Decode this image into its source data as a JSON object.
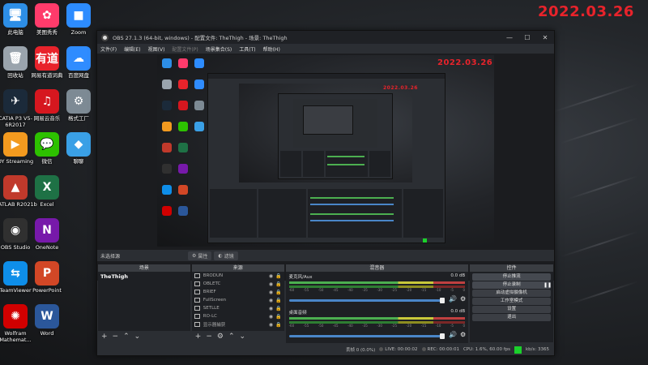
{
  "desktop": {
    "date_stamp": "2022.03.26",
    "icons": [
      {
        "label": "此电脑",
        "icon": "computer-icon",
        "color": "#2d8ee6",
        "glyph": "🖥"
      },
      {
        "label": "美图秀秀",
        "icon": "meitu-icon",
        "color": "#ff3b6b",
        "glyph": "✿"
      },
      {
        "label": "Zoom",
        "icon": "zoom-icon",
        "color": "#2d8cff",
        "glyph": "■"
      },
      {
        "label": "回收站",
        "icon": "recycle-bin-icon",
        "color": "#9aa4ad",
        "glyph": "🗑"
      },
      {
        "label": "网易有道词典",
        "icon": "youdao-icon",
        "color": "#e8232b",
        "glyph": "有道"
      },
      {
        "label": "百度网盘",
        "icon": "baidu-netdisk-icon",
        "color": "#2f8cff",
        "glyph": "☁"
      },
      {
        "label": "CATIA P3 V5-6R2017",
        "icon": "catia-icon",
        "color": "#1b2a3a",
        "glyph": "✈"
      },
      {
        "label": "网易云音乐",
        "icon": "netease-music-icon",
        "color": "#d6171f",
        "glyph": "♫"
      },
      {
        "label": "格式工厂",
        "icon": "format-factory-icon",
        "color": "#7d8a94",
        "glyph": "⚙"
      },
      {
        "label": "DY Streaming",
        "icon": "dy-streaming-icon",
        "color": "#f39a1f",
        "glyph": "▶"
      },
      {
        "label": "微信",
        "icon": "wechat-icon",
        "color": "#2dc100",
        "glyph": "💬"
      },
      {
        "label": "聊聊",
        "icon": "chat-icon",
        "color": "#3aa0e6",
        "glyph": "◆"
      },
      {
        "label": "MATLAB R2021b",
        "icon": "matlab-icon",
        "color": "#c0392b",
        "glyph": "▲"
      },
      {
        "label": "Excel",
        "icon": "excel-icon",
        "color": "#1e7145",
        "glyph": "X"
      },
      {
        "label": "OBS Studio",
        "icon": "obs-icon",
        "color": "#303030",
        "glyph": "◉"
      },
      {
        "label": "OneNote",
        "icon": "onenote-icon",
        "color": "#7719aa",
        "glyph": "N"
      },
      {
        "label": "TeamViewer",
        "icon": "teamviewer-icon",
        "color": "#0e8ee9",
        "glyph": "⇆"
      },
      {
        "label": "PowerPoint",
        "icon": "powerpoint-icon",
        "color": "#d24726",
        "glyph": "P"
      },
      {
        "label": "Wolfram Mathemat...",
        "icon": "wolfram-icon",
        "color": "#d10000",
        "glyph": "✺"
      },
      {
        "label": "Word",
        "icon": "word-icon",
        "color": "#2b579a",
        "glyph": "W"
      }
    ]
  },
  "obs": {
    "title": "OBS 27.1.3 (64-bit, windows) - 配置文件: TheThigh - 场景: TheThigh",
    "menu": [
      "文件(F)",
      "编辑(E)",
      "视图(V)",
      "配置文件(P)",
      "场景集合(S)",
      "工具(T)",
      "帮助(H)"
    ],
    "menu_disabled_index": 3,
    "scene_bar": {
      "label": "未选择源",
      "properties": "属性",
      "filters": "滤镜"
    },
    "docks": {
      "scenes": {
        "title": "场景",
        "items": [
          "TheThigh"
        ]
      },
      "sources": {
        "title": "来源",
        "items": [
          "BRODUN",
          "OBLETC",
          "BRIEF",
          "FullScreen",
          "SETLLE",
          "RO-LC",
          "显示器捕获"
        ]
      },
      "mixer": {
        "title": "混音器",
        "channels": [
          {
            "name": "麦克风/Aux",
            "level": "0.0 dB"
          },
          {
            "name": "桌面音频",
            "level": "0.0 dB"
          }
        ],
        "ticks": [
          "-60",
          "-55",
          "-50",
          "-45",
          "-40",
          "-35",
          "-30",
          "-25",
          "-20",
          "-15",
          "-10",
          "-5",
          "0"
        ]
      },
      "controls": {
        "title": "控件",
        "buttons": [
          "停止推流",
          "停止录制",
          "启动虚拟摄像机",
          "工作室模式",
          "设置",
          "退出"
        ]
      }
    },
    "status": {
      "dropped": "丢帧 0 (0.0%)",
      "live": "LIVE: 00:00:02",
      "rec": "REC: 00:00:01",
      "cpu": "CPU: 1.6%, 60.00 fps",
      "kbps": "kb/s: 3365"
    }
  },
  "colors": {
    "date_red": "#e8232b",
    "stream_green": "#1bd12b",
    "accent_blue": "#4a86c8"
  }
}
